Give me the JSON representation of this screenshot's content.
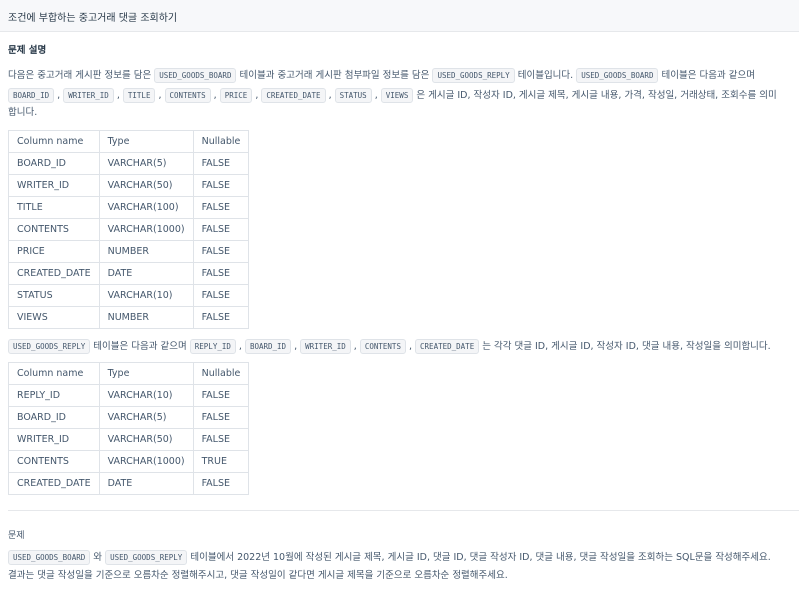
{
  "header": {
    "title": "조건에 부합하는 중고거래 댓글 조회하기"
  },
  "description": {
    "title": "문제 설명",
    "intro_1": "다음은 중고거래 게시판 정보를 담은",
    "code_board": "USED_GOODS_BOARD",
    "intro_2": "테이블과 중고거래 게시판 첨부파일 정보를 담은",
    "code_reply": "USED_GOODS_REPLY",
    "intro_3": "테이블입니다.",
    "intro_4": "테이블은 다음과 같으며",
    "board_cols": [
      "BOARD_ID",
      "WRITER_ID",
      "TITLE",
      "CONTENTS",
      "PRICE",
      "CREATED_DATE",
      "STATUS",
      "VIEWS"
    ],
    "board_desc": "은 게시글 ID, 작성자 ID, 게시글 제목, 게시글 내용, 가격, 작성일, 거래상태, 조회수를 의미",
    "board_desc_end": "합니다.",
    "reply_intro": "테이블은 다음과 같으며",
    "reply_cols": [
      "REPLY_ID",
      "BOARD_ID",
      "WRITER_ID",
      "CONTENTS",
      "CREATED_DATE"
    ],
    "reply_desc": "는 각각 댓글 ID, 게시글 ID, 작성자 ID, 댓글 내용, 작성일을 의미합니다."
  },
  "table_headers": [
    "Column name",
    "Type",
    "Nullable"
  ],
  "board_table": [
    [
      "BOARD_ID",
      "VARCHAR(5)",
      "FALSE"
    ],
    [
      "WRITER_ID",
      "VARCHAR(50)",
      "FALSE"
    ],
    [
      "TITLE",
      "VARCHAR(100)",
      "FALSE"
    ],
    [
      "CONTENTS",
      "VARCHAR(1000)",
      "FALSE"
    ],
    [
      "PRICE",
      "NUMBER",
      "FALSE"
    ],
    [
      "CREATED_DATE",
      "DATE",
      "FALSE"
    ],
    [
      "STATUS",
      "VARCHAR(10)",
      "FALSE"
    ],
    [
      "VIEWS",
      "NUMBER",
      "FALSE"
    ]
  ],
  "reply_table": [
    [
      "REPLY_ID",
      "VARCHAR(10)",
      "FALSE"
    ],
    [
      "BOARD_ID",
      "VARCHAR(5)",
      "FALSE"
    ],
    [
      "WRITER_ID",
      "VARCHAR(50)",
      "FALSE"
    ],
    [
      "CONTENTS",
      "VARCHAR(1000)",
      "TRUE"
    ],
    [
      "CREATED_DATE",
      "DATE",
      "FALSE"
    ]
  ],
  "question": {
    "title": "문제",
    "code_board": "USED_GOODS_BOARD",
    "and": "와",
    "code_reply": "USED_GOODS_REPLY",
    "text_1": "테이블에서 2022년 10월에 작성된 게시글 제목, 게시글 ID, 댓글 ID, 댓글 작성자 ID, 댓글 내용, 댓글 작성일을 조회하는 SQL문을 작성해주세요.",
    "text_2": "결과는 댓글 작성일을 기준으로 오름차순 정렬해주시고, 댓글 작성일이 같다면 게시글 제목을 기준으로 오름차순 정렬해주세요."
  }
}
